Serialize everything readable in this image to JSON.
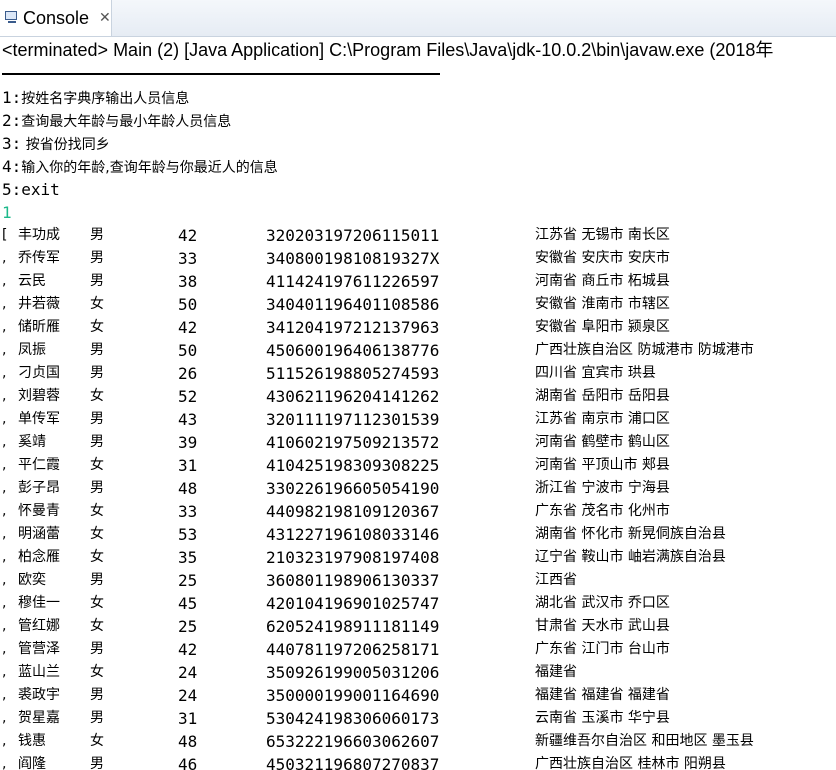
{
  "tab": {
    "title": "Console",
    "close_glyph": "✕",
    "icon": "console-icon"
  },
  "status": "<terminated> Main (2) [Java Application] C:\\Program Files\\Java\\jdk-10.0.2\\bin\\javaw.exe (2018年",
  "menu": [
    {
      "num": "1:",
      "text": "按姓名字典序输出人员信息"
    },
    {
      "num": "2:",
      "text": "查询最大年龄与最小年龄人员信息"
    },
    {
      "num": "3:",
      "text": " 按省份找同乡"
    },
    {
      "num": "4:",
      "text": "输入你的年龄,查询年龄与你最近人的信息"
    },
    {
      "num": "5:",
      "text": "exit"
    }
  ],
  "user_input": "1",
  "input_color": "#1cb88a",
  "rows": [
    {
      "prefix": "[",
      "name": "丰功成",
      "gender": "男",
      "age": "42",
      "id": "320203197206115011",
      "addr": "江苏省 无锡市 南长区"
    },
    {
      "prefix": ",",
      "name": "乔传军",
      "gender": "男",
      "age": "33",
      "id": "34080019810819327X",
      "addr": "安徽省 安庆市 安庆市"
    },
    {
      "prefix": ",",
      "name": "云民",
      "gender": "男",
      "age": "38",
      "id": "411424197611226597",
      "addr": "河南省 商丘市 柘城县"
    },
    {
      "prefix": ",",
      "name": "井若薇",
      "gender": "女",
      "age": "50",
      "id": "340401196401108586",
      "addr": "安徽省 淮南市 市辖区"
    },
    {
      "prefix": ",",
      "name": "储昕雁",
      "gender": "女",
      "age": "42",
      "id": "341204197212137963",
      "addr": "安徽省 阜阳市 颍泉区"
    },
    {
      "prefix": ",",
      "name": "凤振",
      "gender": "男",
      "age": "50",
      "id": "450600196406138776",
      "addr": "广西壮族自治区 防城港市 防城港市"
    },
    {
      "prefix": ",",
      "name": "刁贞国",
      "gender": "男",
      "age": "26",
      "id": "511526198805274593",
      "addr": "四川省 宜宾市 珙县"
    },
    {
      "prefix": ",",
      "name": "刘碧蓉",
      "gender": "女",
      "age": "52",
      "id": "430621196204141262",
      "addr": "湖南省 岳阳市 岳阳县"
    },
    {
      "prefix": ",",
      "name": "单传军",
      "gender": "男",
      "age": "43",
      "id": "320111197112301539",
      "addr": "江苏省 南京市 浦口区"
    },
    {
      "prefix": ",",
      "name": "奚靖",
      "gender": "男",
      "age": "39",
      "id": "410602197509213572",
      "addr": "河南省 鹤壁市 鹤山区"
    },
    {
      "prefix": ",",
      "name": "平仁霞",
      "gender": "女",
      "age": "31",
      "id": "410425198309308225",
      "addr": "河南省 平顶山市 郏县"
    },
    {
      "prefix": ",",
      "name": "彭子昂",
      "gender": "男",
      "age": "48",
      "id": "330226196605054190",
      "addr": "浙江省 宁波市 宁海县"
    },
    {
      "prefix": ",",
      "name": "怀曼青",
      "gender": "女",
      "age": "33",
      "id": "440982198109120367",
      "addr": "广东省 茂名市 化州市"
    },
    {
      "prefix": ",",
      "name": "明涵蕾",
      "gender": "女",
      "age": "53",
      "id": "431227196108033146",
      "addr": "湖南省 怀化市 新晃侗族自治县"
    },
    {
      "prefix": ",",
      "name": "柏念雁",
      "gender": "女",
      "age": "35",
      "id": "210323197908197408",
      "addr": "辽宁省 鞍山市 岫岩满族自治县"
    },
    {
      "prefix": ",",
      "name": "欧奕",
      "gender": "男",
      "age": "25",
      "id": "360801198906130337",
      "addr": "江西省"
    },
    {
      "prefix": ",",
      "name": "穆佳一",
      "gender": "女",
      "age": "45",
      "id": "420104196901025747",
      "addr": "湖北省 武汉市 乔口区"
    },
    {
      "prefix": ",",
      "name": "管红娜",
      "gender": "女",
      "age": "25",
      "id": "620524198911181149",
      "addr": "甘肃省 天水市 武山县"
    },
    {
      "prefix": ",",
      "name": "管营泽",
      "gender": "男",
      "age": "42",
      "id": "440781197206258171",
      "addr": "广东省 江门市 台山市"
    },
    {
      "prefix": ",",
      "name": "蓝山兰",
      "gender": "女",
      "age": "24",
      "id": "350926199005031206",
      "addr": "福建省"
    },
    {
      "prefix": ",",
      "name": "裘政宇",
      "gender": "男",
      "age": "24",
      "id": "350000199001164690",
      "addr": "福建省 福建省 福建省"
    },
    {
      "prefix": ",",
      "name": "贺星嘉",
      "gender": "男",
      "age": "31",
      "id": "530424198306060173",
      "addr": "云南省 玉溪市 华宁县"
    },
    {
      "prefix": ",",
      "name": "钱惠",
      "gender": "女",
      "age": "48",
      "id": "653222196603062607",
      "addr": "新疆维吾尔自治区 和田地区 墨玉县"
    },
    {
      "prefix": ",",
      "name": "阎隆",
      "gender": "男",
      "age": "46",
      "id": "450321196807270837",
      "addr": "广西壮族自治区 桂林市 阳朔县"
    }
  ]
}
